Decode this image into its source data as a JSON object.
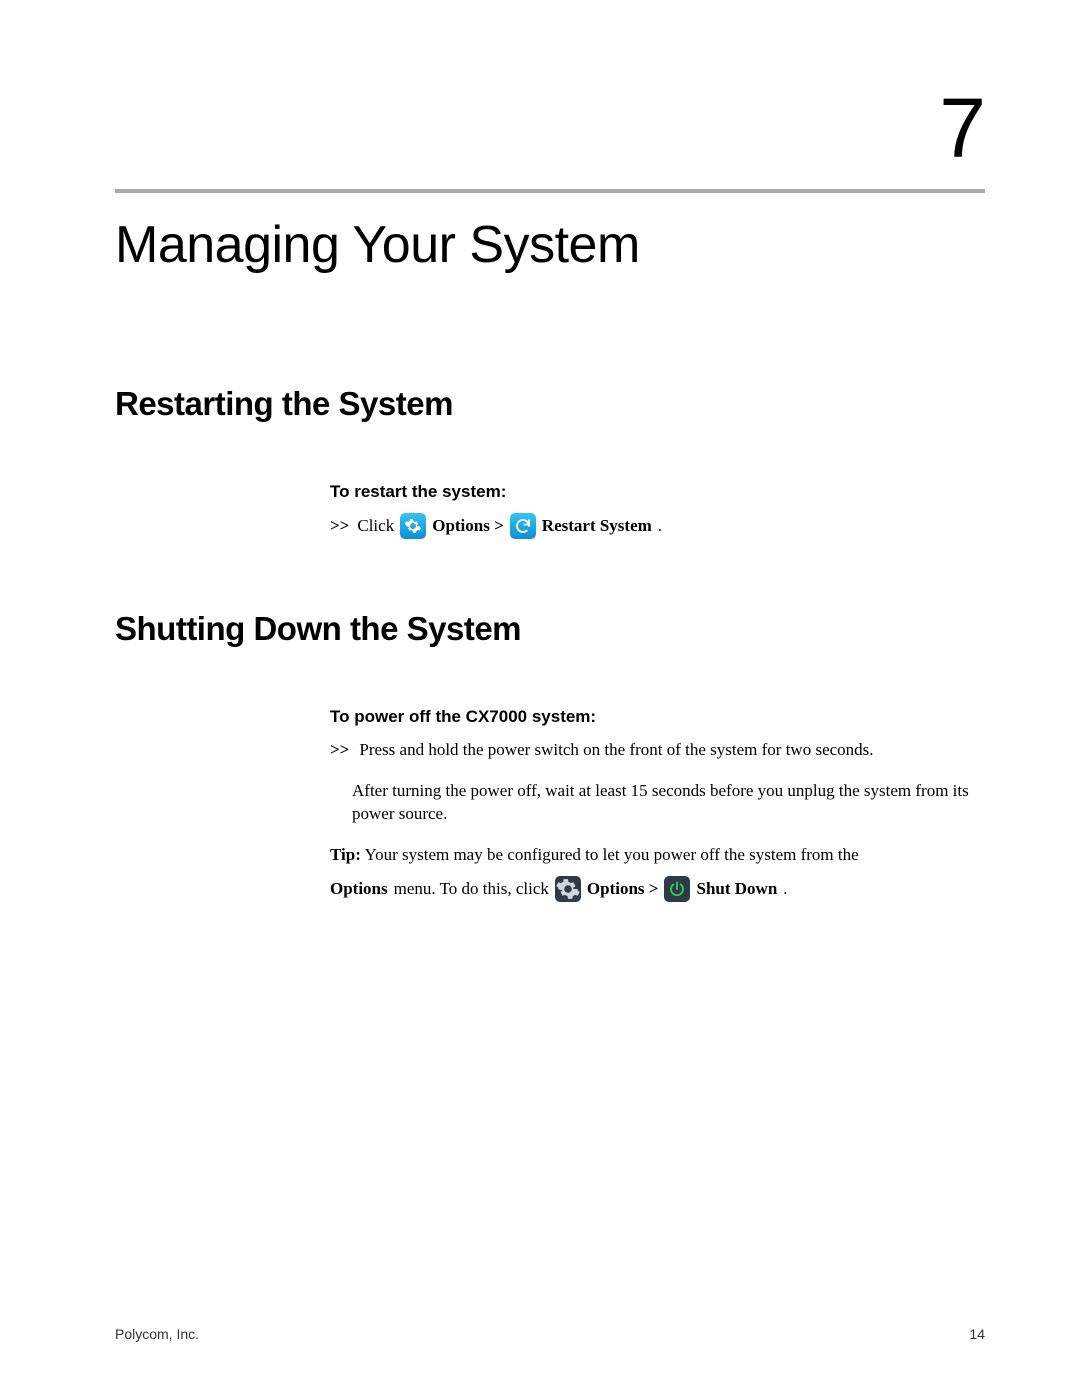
{
  "chapter": {
    "number": "7",
    "title": "Managing Your System"
  },
  "section1": {
    "heading": "Restarting the System",
    "proc_heading": "To restart the system:",
    "step_marker": ">>",
    "click": "Click",
    "options": "Options >",
    "restart_system": "Restart System",
    "dot": "."
  },
  "section2": {
    "heading": "Shutting Down the System",
    "proc_heading": "To power off the CX7000 system:",
    "step_marker": ">>",
    "step_text": "Press and hold the power switch on the front of the system for two seconds.",
    "after_text": "After turning the power off, wait at least 15 seconds before you unplug the system from its power source.",
    "tip_label": "Tip:",
    "tip_text1": "Your system may be configured to let you power off the system from the",
    "options_word": "Options",
    "menu_text": "menu. To do this, click",
    "options2": "Options >",
    "shutdown": "Shut Down",
    "dot": "."
  },
  "footer": {
    "left": "Polycom, Inc.",
    "right": "14"
  }
}
